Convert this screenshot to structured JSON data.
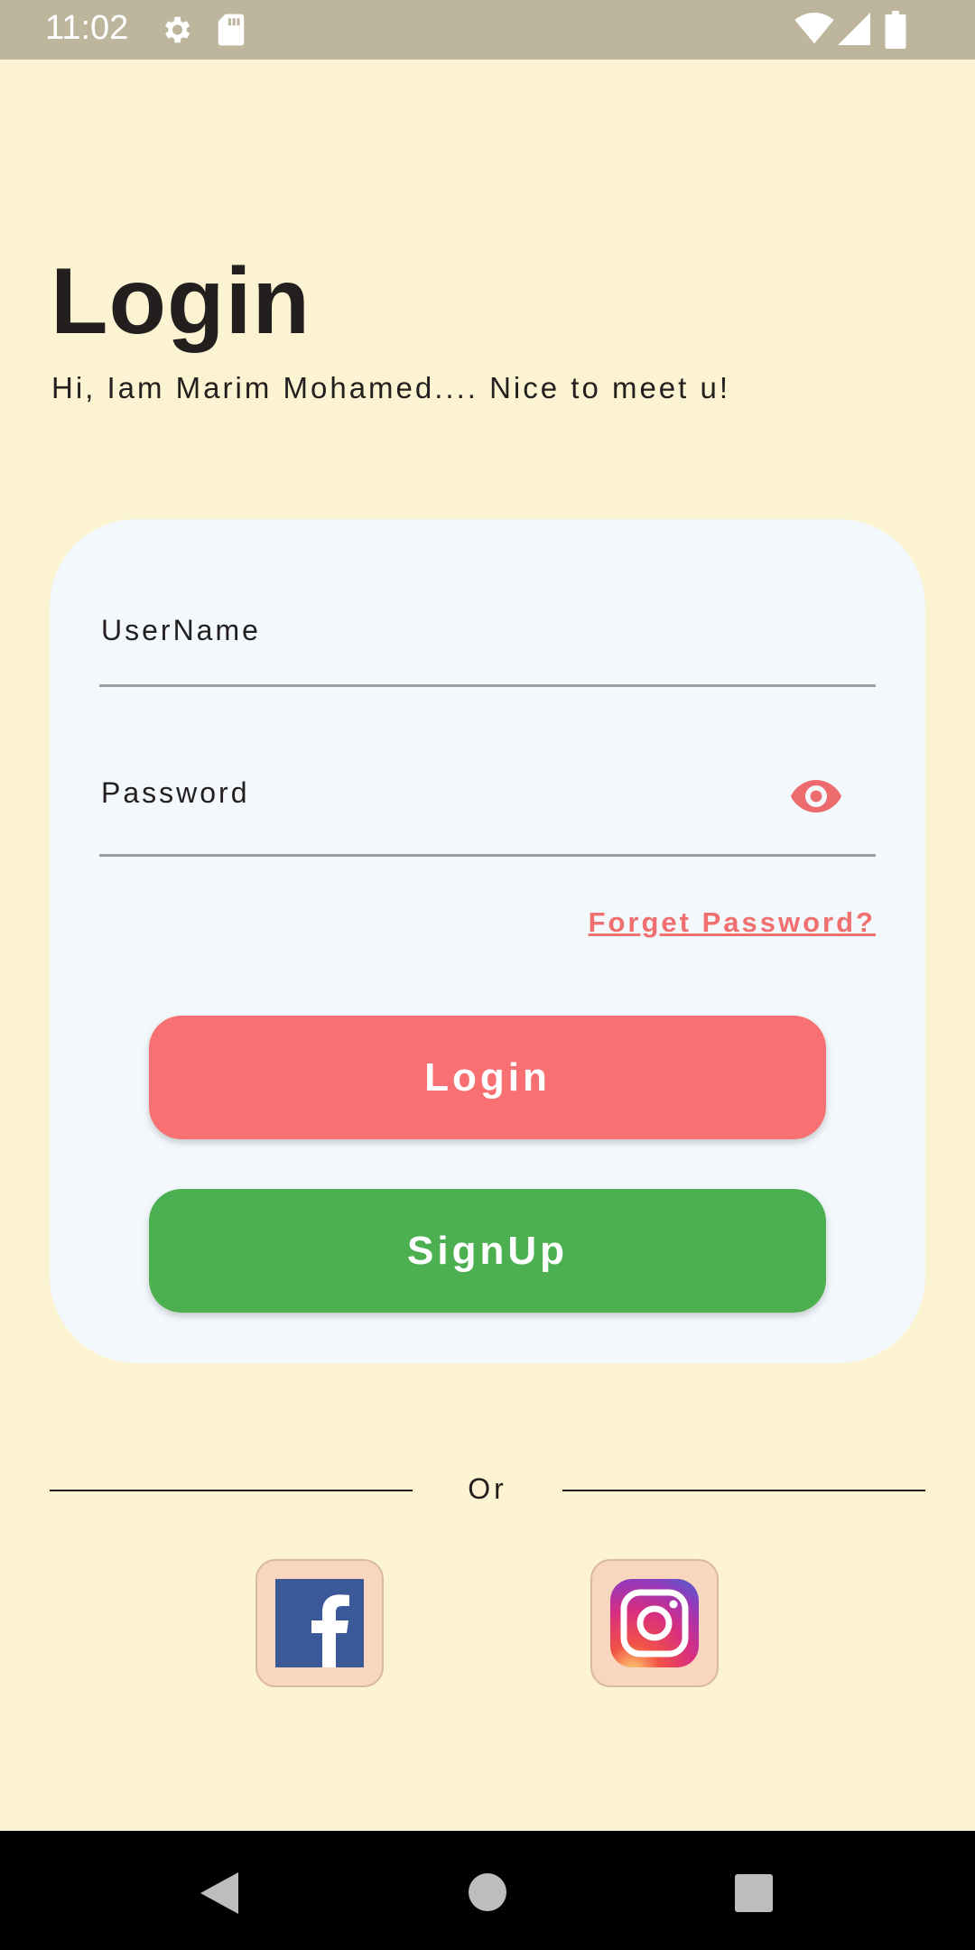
{
  "status_bar": {
    "time": "11:02",
    "icons": [
      "gear-icon",
      "sd-card-icon",
      "wifi-icon",
      "signal-icon",
      "battery-icon"
    ]
  },
  "header": {
    "title": "Login",
    "subtitle": "Hi, Iam Marim Mohamed.... Nice to meet u!"
  },
  "form": {
    "username_label": "UserName",
    "password_label": "Password",
    "forget_password": "Forget Password?",
    "login_button": "Login",
    "signup_button": "SignUp"
  },
  "divider": {
    "text": "Or"
  },
  "social": {
    "items": [
      "facebook-icon",
      "instagram-icon"
    ]
  },
  "colors": {
    "background": "#FBF3D1",
    "card": "#F2F8FB",
    "accent": "#F87071",
    "signup": "#4CAF50",
    "social_tile": "#F9D6BE"
  }
}
